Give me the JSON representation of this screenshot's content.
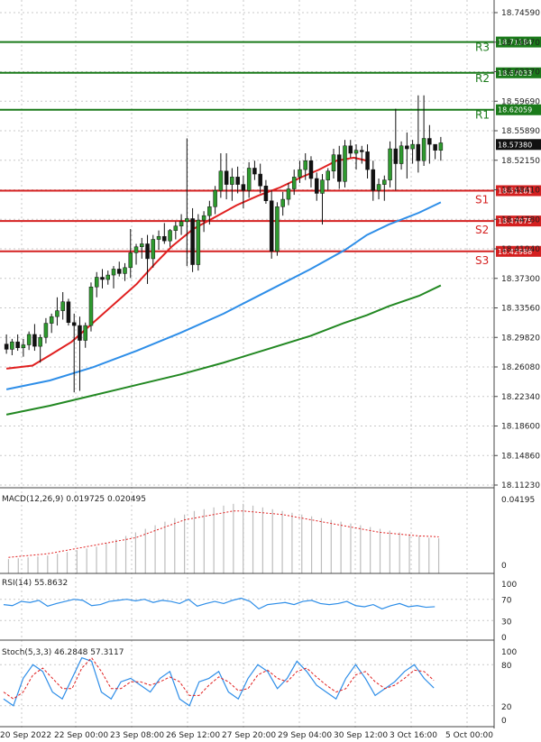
{
  "chart_data": [
    {
      "type": "candlestick",
      "panel": "price",
      "ylim": [
        18.1115,
        18.766
      ],
      "y_ticks": [
        "18.74590",
        "18.70670",
        "18.63370",
        "18.59690",
        "18.55890",
        "18.52150",
        "18.48410",
        "18.44780",
        "18.41040",
        "18.37300",
        "18.33560",
        "18.29820",
        "18.26080",
        "18.22340",
        "18.18600",
        "18.14860",
        "18.11230"
      ],
      "x_ticks": [
        "20 Sep 2022",
        "22 Sep 00:00",
        "23 Sep 08:00",
        "26 Sep 12:00",
        "27 Sep 20:00",
        "29 Sep 04:00",
        "30 Sep 12:00",
        "3 Oct 16:00",
        "5 Oct 00:00"
      ],
      "grid": true,
      "current_price": "18.57380",
      "levels": [
        {
          "name": "R3",
          "value": 18.71184,
          "label": "18.71184",
          "color": "#1a7a1a"
        },
        {
          "name": "R2",
          "value": 18.67033,
          "label": "18.67033",
          "color": "#1a7a1a"
        },
        {
          "name": "R1",
          "value": 18.62059,
          "label": "18.62059",
          "color": "#1a7a1a"
        },
        {
          "name": "S1",
          "value": 18.51161,
          "label": "18.51161",
          "color": "#d42020"
        },
        {
          "name": "S2",
          "value": 18.47075,
          "label": "18.47075",
          "color": "#d42020"
        },
        {
          "name": "S3",
          "value": 18.42988,
          "label": "18.42988",
          "color": "#d42020"
        }
      ],
      "candles": [
        [
          18.305,
          18.318,
          18.292,
          18.298
        ],
        [
          18.298,
          18.312,
          18.29,
          18.308
        ],
        [
          18.308,
          18.318,
          18.296,
          18.3
        ],
        [
          18.3,
          18.312,
          18.288,
          18.304
        ],
        [
          18.304,
          18.322,
          18.297,
          18.318
        ],
        [
          18.318,
          18.332,
          18.296,
          18.302
        ],
        [
          18.302,
          18.318,
          18.28,
          18.314
        ],
        [
          18.314,
          18.34,
          18.306,
          18.333
        ],
        [
          18.333,
          18.346,
          18.32,
          18.342
        ],
        [
          18.342,
          18.368,
          18.33,
          18.35
        ],
        [
          18.35,
          18.375,
          18.338,
          18.362
        ],
        [
          18.362,
          18.366,
          18.33,
          18.334
        ],
        [
          18.334,
          18.346,
          18.24,
          18.33
        ],
        [
          18.33,
          18.342,
          18.242,
          18.31
        ],
        [
          18.31,
          18.334,
          18.3,
          18.33
        ],
        [
          18.33,
          18.388,
          18.322,
          18.382
        ],
        [
          18.382,
          18.402,
          18.368,
          18.395
        ],
        [
          18.395,
          18.406,
          18.38,
          18.392
        ],
        [
          18.392,
          18.404,
          18.385,
          18.398
        ],
        [
          18.398,
          18.41,
          18.38,
          18.406
        ],
        [
          18.406,
          18.416,
          18.396,
          18.4
        ],
        [
          18.4,
          18.414,
          18.39,
          18.408
        ],
        [
          18.408,
          18.46,
          18.394,
          18.428
        ],
        [
          18.428,
          18.44,
          18.412,
          18.436
        ],
        [
          18.436,
          18.448,
          18.42,
          18.44
        ],
        [
          18.44,
          18.452,
          18.386,
          18.42
        ],
        [
          18.42,
          18.452,
          18.408,
          18.446
        ],
        [
          18.446,
          18.458,
          18.432,
          18.45
        ],
        [
          18.45,
          18.468,
          18.44,
          18.444
        ],
        [
          18.444,
          18.46,
          18.436,
          18.458
        ],
        [
          18.458,
          18.47,
          18.446,
          18.464
        ],
        [
          18.464,
          18.48,
          18.452,
          18.47
        ],
        [
          18.47,
          18.582,
          18.41,
          18.474
        ],
        [
          18.474,
          18.488,
          18.402,
          18.412
        ],
        [
          18.412,
          18.48,
          18.404,
          18.472
        ],
        [
          18.472,
          18.484,
          18.456,
          18.478
        ],
        [
          18.478,
          18.498,
          18.466,
          18.49
        ],
        [
          18.49,
          18.518,
          18.48,
          18.512
        ],
        [
          18.512,
          18.562,
          18.502,
          18.538
        ],
        [
          18.538,
          18.562,
          18.5,
          18.52
        ],
        [
          18.52,
          18.542,
          18.498,
          18.53
        ],
        [
          18.53,
          18.544,
          18.508,
          18.52
        ],
        [
          18.52,
          18.532,
          18.488,
          18.512
        ],
        [
          18.512,
          18.55,
          18.502,
          18.542
        ],
        [
          18.542,
          18.552,
          18.526,
          18.534
        ],
        [
          18.534,
          18.548,
          18.508,
          18.518
        ],
        [
          18.518,
          18.526,
          18.494,
          18.498
        ],
        [
          18.498,
          18.512,
          18.42,
          18.43
        ],
        [
          18.43,
          18.496,
          18.424,
          18.49
        ],
        [
          18.49,
          18.51,
          18.478,
          18.5
        ],
        [
          18.5,
          18.522,
          18.492,
          18.514
        ],
        [
          18.514,
          18.54,
          18.506,
          18.53
        ],
        [
          18.53,
          18.552,
          18.522,
          18.54
        ],
        [
          18.54,
          18.562,
          18.526,
          18.552
        ],
        [
          18.552,
          18.558,
          18.516,
          18.528
        ],
        [
          18.528,
          18.536,
          18.498,
          18.508
        ],
        [
          18.508,
          18.534,
          18.466,
          18.526
        ],
        [
          18.526,
          18.542,
          18.512,
          18.538
        ],
        [
          18.538,
          18.568,
          18.528,
          18.56
        ],
        [
          18.56,
          18.572,
          18.514,
          18.524
        ],
        [
          18.524,
          18.58,
          18.516,
          18.572
        ],
        [
          18.572,
          18.58,
          18.556,
          18.562
        ],
        [
          18.562,
          18.574,
          18.54,
          18.566
        ],
        [
          18.566,
          18.572,
          18.548,
          18.564
        ],
        [
          18.564,
          18.574,
          18.528,
          18.54
        ],
        [
          18.54,
          18.552,
          18.498,
          18.512
        ],
        [
          18.512,
          18.528,
          18.5,
          18.52
        ],
        [
          18.52,
          18.532,
          18.498,
          18.526
        ],
        [
          18.526,
          18.578,
          18.516,
          18.568
        ],
        [
          18.568,
          18.622,
          18.512,
          18.548
        ],
        [
          18.548,
          18.578,
          18.54,
          18.572
        ],
        [
          18.572,
          18.59,
          18.528,
          18.568
        ],
        [
          18.568,
          18.58,
          18.548,
          18.574
        ],
        [
          18.574,
          18.64,
          18.536,
          18.552
        ],
        [
          18.552,
          18.64,
          18.545,
          18.582
        ],
        [
          18.582,
          18.6,
          18.548,
          18.574
        ],
        [
          18.574,
          18.574,
          18.554,
          18.566
        ],
        [
          18.566,
          18.584,
          18.552,
          18.576
        ]
      ],
      "series": [
        {
          "name": "",
          "color": "#e02020",
          "values": [
            [
              0,
              18.272
            ],
            [
              6,
              18.276
            ],
            [
              10,
              18.29
            ],
            [
              15,
              18.308
            ],
            [
              20,
              18.334
            ],
            [
              25,
              18.36
            ],
            [
              30,
              18.386
            ],
            [
              34,
              18.412
            ],
            [
              38,
              18.436
            ],
            [
              43,
              18.46
            ],
            [
              48,
              18.476
            ],
            [
              53,
              18.492
            ],
            [
              58,
              18.505
            ],
            [
              63,
              18.516
            ],
            [
              68,
              18.53
            ],
            [
              72,
              18.54
            ],
            [
              76,
              18.552
            ],
            [
              80,
              18.556
            ],
            [
              83,
              18.552
            ]
          ]
        },
        {
          "name": "",
          "color": "#2e8ee8",
          "values": [
            [
              0,
              18.244
            ],
            [
              10,
              18.256
            ],
            [
              20,
              18.274
            ],
            [
              30,
              18.296
            ],
            [
              40,
              18.32
            ],
            [
              50,
              18.346
            ],
            [
              60,
              18.376
            ],
            [
              70,
              18.406
            ],
            [
              78,
              18.432
            ],
            [
              83,
              18.452
            ],
            [
              88,
              18.466
            ],
            [
              95,
              18.482
            ],
            [
              100,
              18.496
            ]
          ]
        },
        {
          "name": "",
          "color": "#228822",
          "values": [
            [
              0,
              18.21
            ],
            [
              10,
              18.222
            ],
            [
              20,
              18.236
            ],
            [
              30,
              18.25
            ],
            [
              40,
              18.264
            ],
            [
              50,
              18.28
            ],
            [
              60,
              18.298
            ],
            [
              70,
              18.316
            ],
            [
              78,
              18.334
            ],
            [
              83,
              18.344
            ],
            [
              88,
              18.356
            ],
            [
              95,
              18.37
            ],
            [
              100,
              18.384
            ]
          ]
        }
      ]
    },
    {
      "type": "bar",
      "panel": "macd",
      "title": "MACD(12,26,9) 0.019725 0.020495",
      "y_ticks": [
        "0.04195",
        "0"
      ],
      "ylim": [
        0,
        0.04195
      ],
      "values": [
        0.008,
        0.0085,
        0.009,
        0.0095,
        0.01,
        0.011,
        0.012,
        0.013,
        0.014,
        0.015,
        0.017,
        0.019,
        0.021,
        0.023,
        0.025,
        0.027,
        0.029,
        0.031,
        0.033,
        0.035,
        0.036,
        0.037,
        0.038,
        0.039,
        0.039,
        0.038,
        0.037,
        0.036,
        0.035,
        0.034,
        0.033,
        0.032,
        0.031,
        0.03,
        0.029,
        0.028,
        0.027,
        0.026,
        0.025,
        0.024,
        0.023,
        0.022,
        0.021,
        0.02,
        0.0197
      ],
      "signal": [
        0.009,
        0.0095,
        0.01,
        0.0105,
        0.011,
        0.012,
        0.013,
        0.014,
        0.015,
        0.016,
        0.017,
        0.018,
        0.019,
        0.02,
        0.022,
        0.024,
        0.026,
        0.028,
        0.03,
        0.031,
        0.032,
        0.033,
        0.034,
        0.035,
        0.035,
        0.0345,
        0.034,
        0.0335,
        0.033,
        0.032,
        0.031,
        0.03,
        0.029,
        0.028,
        0.027,
        0.026,
        0.025,
        0.024,
        0.023,
        0.0225,
        0.022,
        0.0215,
        0.021,
        0.0208,
        0.0205
      ]
    },
    {
      "type": "line",
      "panel": "rsi",
      "title": "RSI(14) 55.8632",
      "y_ticks": [
        "100",
        "70",
        "30",
        "0"
      ],
      "ylim": [
        0,
        100
      ],
      "values": [
        60,
        58,
        66,
        64,
        68,
        57,
        62,
        66,
        70,
        68,
        58,
        60,
        66,
        68,
        70,
        67,
        70,
        64,
        68,
        66,
        62,
        70,
        57,
        62,
        66,
        62,
        68,
        72,
        66,
        52,
        60,
        62,
        64,
        60,
        66,
        68,
        62,
        60,
        62,
        66,
        58,
        56,
        60,
        52,
        58,
        62,
        56,
        58,
        55,
        56
      ]
    },
    {
      "type": "line",
      "panel": "stoch",
      "title": "Stoch(5,3,3) 46.2848 57.3117",
      "y_ticks": [
        "100",
        "80",
        "20",
        "0"
      ],
      "ylim": [
        0,
        100
      ],
      "values": [
        30,
        20,
        60,
        80,
        70,
        40,
        30,
        60,
        90,
        85,
        40,
        30,
        55,
        60,
        50,
        40,
        60,
        70,
        30,
        20,
        55,
        60,
        70,
        40,
        30,
        60,
        80,
        70,
        45,
        60,
        85,
        70,
        50,
        40,
        30,
        60,
        80,
        60,
        35,
        45,
        55,
        70,
        80,
        60,
        46
      ],
      "signal": [
        40,
        30,
        40,
        65,
        75,
        60,
        45,
        45,
        75,
        90,
        70,
        45,
        45,
        55,
        55,
        50,
        55,
        62,
        55,
        35,
        35,
        50,
        62,
        55,
        42,
        45,
        65,
        72,
        60,
        55,
        70,
        75,
        62,
        50,
        40,
        45,
        65,
        70,
        55,
        45,
        50,
        60,
        72,
        70,
        57
      ]
    }
  ]
}
